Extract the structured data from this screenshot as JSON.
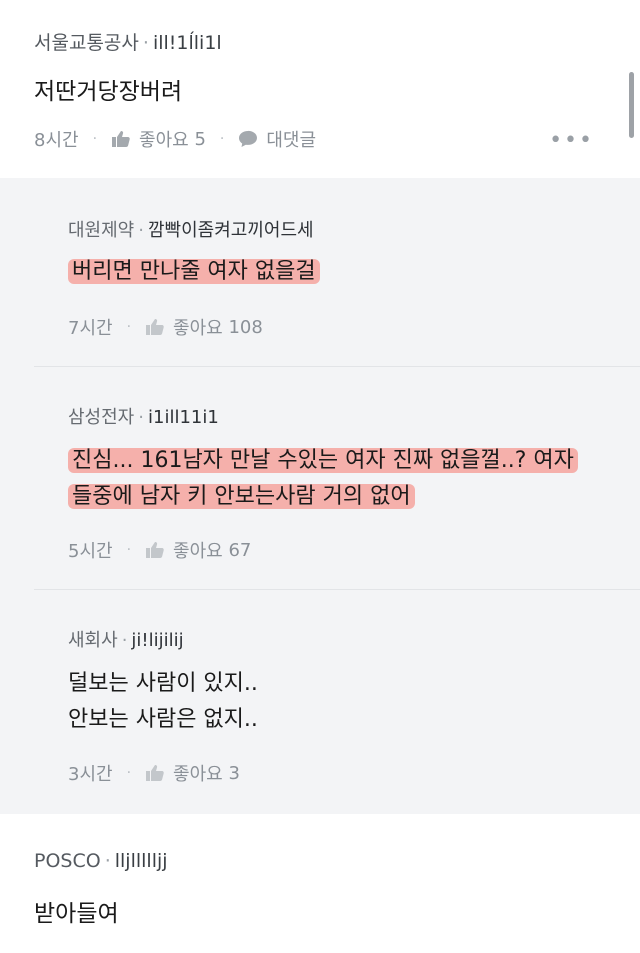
{
  "comment": {
    "company": "서울교통공사",
    "handle": "ill!1ĺli1l",
    "text": "저딴거당장버려",
    "time": "8시간",
    "like_label": "좋아요",
    "like_count": "5",
    "reply_label": "대댓글",
    "more_label": "•••"
  },
  "replies": [
    {
      "company": "대원제약",
      "handle": "깜빡이좀켜고끼어드세",
      "lines": [
        "버리면 만나줄 여자 없을걸"
      ],
      "highlighted": true,
      "time": "7시간",
      "like_label": "좋아요",
      "like_count": "108"
    },
    {
      "company": "삼성전자",
      "handle": "i1ill11i1",
      "lines": [
        "진심... 161남자 만날 수있는 여자 진짜 없을껄..? 여자",
        "들중에 남자 키 안보는사람 거의 없어"
      ],
      "highlighted": true,
      "time": "5시간",
      "like_label": "좋아요",
      "like_count": "67"
    },
    {
      "company": "새회사",
      "handle": "ji!lijilij",
      "lines": [
        "덜보는 사람이 있지..",
        "안보는 사람은 없지.."
      ],
      "highlighted": false,
      "time": "3시간",
      "like_label": "좋아요",
      "like_count": "3"
    }
  ],
  "next_comment": {
    "company": "POSCO",
    "handle": "lljllllljj",
    "text": "받아들여"
  },
  "colors": {
    "highlight": "#f5786e",
    "reply_background": "#f3f4f6",
    "meta_text": "#8a9097"
  },
  "icons": {
    "like": "thumbs-up-icon",
    "reply": "speech-bubble-icon",
    "more": "more-dots-icon"
  }
}
